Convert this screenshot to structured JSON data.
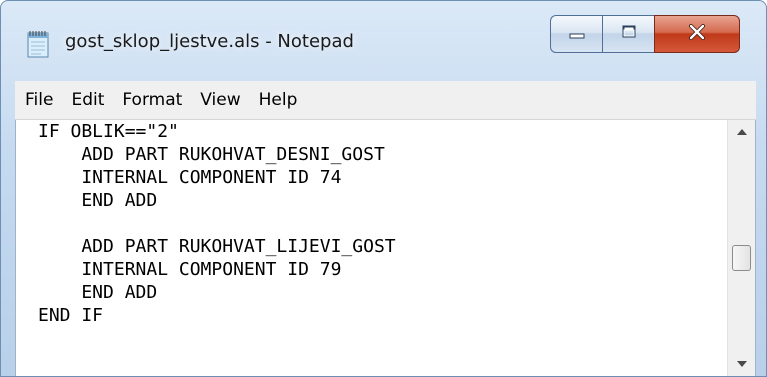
{
  "window": {
    "title": "gost_sklop_ljestve.als - Notepad",
    "app_icon": "notepad-icon"
  },
  "caption_buttons": {
    "minimize_icon": "minimize-icon",
    "maximize_icon": "maximize-icon",
    "close_icon": "close-icon",
    "close_color": "#c0391a"
  },
  "menu": {
    "items": [
      {
        "label": "File"
      },
      {
        "label": "Edit"
      },
      {
        "label": "Format"
      },
      {
        "label": "View"
      },
      {
        "label": "Help"
      }
    ]
  },
  "editor": {
    "lines": [
      "IF OBLIK==\"2\"",
      "    ADD PART RUKOHVAT_DESNI_GOST",
      "    INTERNAL COMPONENT ID 74",
      "    END ADD",
      "",
      "    ADD PART RUKOHVAT_LIJEVI_GOST",
      "    INTERNAL COMPONENT ID 79",
      "    END ADD",
      "END IF"
    ]
  },
  "scrollbar": {
    "up_icon": "scroll-up-arrow-icon",
    "down_icon": "scroll-down-arrow-icon",
    "position_fraction": 0.55
  }
}
